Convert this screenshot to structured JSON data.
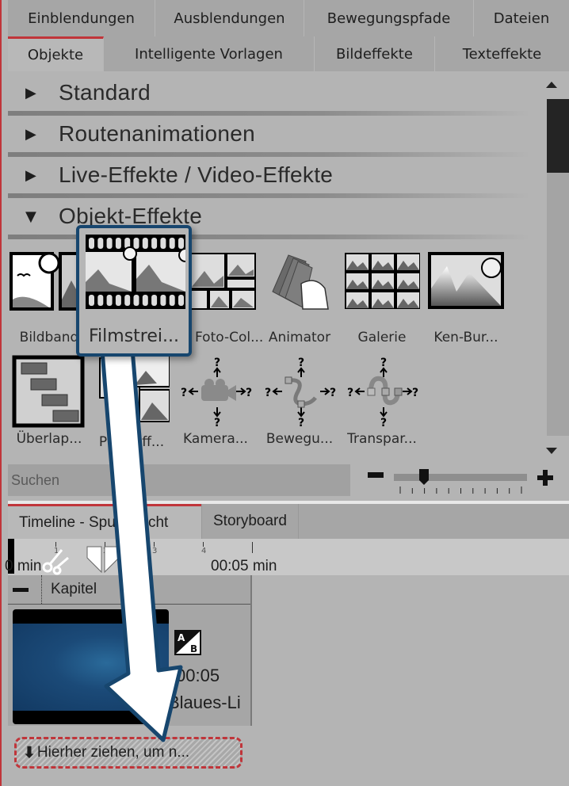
{
  "tabs_row1": [
    {
      "label": "Einblendungen",
      "active": false
    },
    {
      "label": "Ausblendungen",
      "active": false
    },
    {
      "label": "Bewegungspfade",
      "active": false
    },
    {
      "label": "Dateien",
      "active": false
    }
  ],
  "tabs_row2": [
    {
      "label": "Objekte",
      "active": true
    },
    {
      "label": "Intelligente Vorlagen",
      "active": false
    },
    {
      "label": "Bildeffekte",
      "active": false
    },
    {
      "label": "Texteffekte",
      "active": false
    }
  ],
  "sections": [
    {
      "label": "Standard",
      "expanded": false,
      "icon": "triangle-right-icon"
    },
    {
      "label": "Routenanimationen",
      "expanded": false,
      "icon": "triangle-right-icon"
    },
    {
      "label": "Live-Effekte / Video-Effekte",
      "expanded": false,
      "icon": "triangle-right-icon"
    },
    {
      "label": "Objekt-Effekte",
      "expanded": true,
      "icon": "triangle-down-icon"
    }
  ],
  "effects": [
    {
      "label": "Bildband",
      "icon": "bildband-icon"
    },
    {
      "label": "Filmstrei...",
      "icon": "filmstrip-icon"
    },
    {
      "label": "Foto-Col...",
      "icon": "photo-collage-icon"
    },
    {
      "label": "Animator",
      "icon": "flipbook-icon"
    },
    {
      "label": "Galerie",
      "icon": "gallery-grid-icon"
    },
    {
      "label": "Ken-Bur...",
      "icon": "ken-burns-icon"
    },
    {
      "label": "Überlap...",
      "icon": "overlap-icon"
    },
    {
      "label": "Pfad-Eff...",
      "icon": "path-effect-icon"
    },
    {
      "label": "Kamera...",
      "icon": "camera-move-icon"
    },
    {
      "label": "Bewegu...",
      "icon": "motion-path-icon"
    },
    {
      "label": "Transpar...",
      "icon": "transparency-path-icon"
    }
  ],
  "drag_preview": {
    "label": "Filmstrei...",
    "icon": "filmstrip-icon"
  },
  "search": {
    "placeholder": "Suchen",
    "value": ""
  },
  "zoom_slider": {
    "value_fraction": 0.18,
    "ticks": 11
  },
  "timeline_tabs": [
    {
      "label": "Timeline - Spuransicht",
      "active": true
    },
    {
      "label": "Storyboard",
      "active": false
    }
  ],
  "ruler": {
    "start_label": "0 min",
    "ticks": [
      "1",
      "2",
      "3",
      "4"
    ],
    "end_label": "00:05 min"
  },
  "chapter": {
    "label": "Kapitel"
  },
  "clip": {
    "duration": "00:05",
    "name": "Blaues-Li",
    "transition_icon": "ab-transition-icon"
  },
  "dropzone": {
    "label": "Hierher ziehen, um n..."
  }
}
